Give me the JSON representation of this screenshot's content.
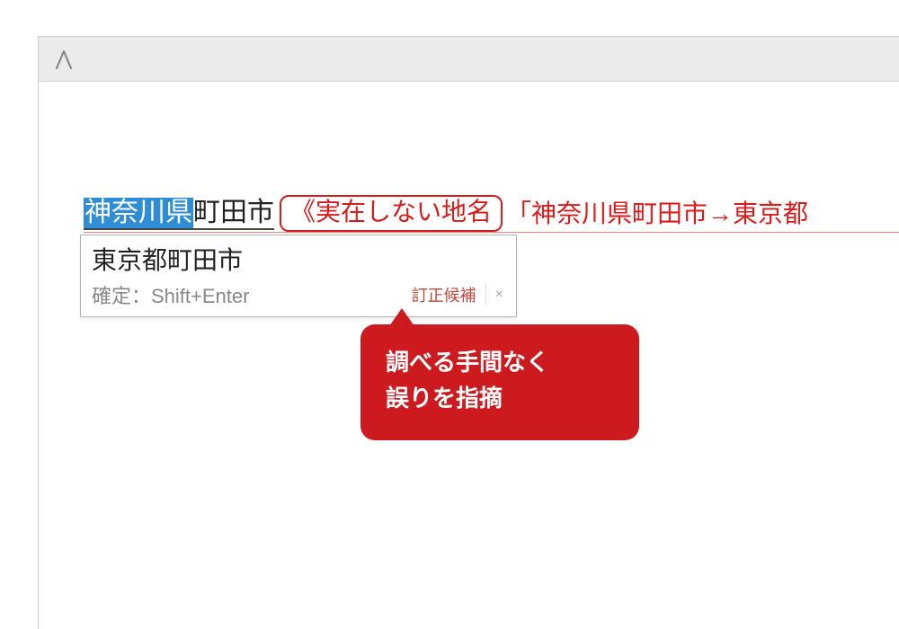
{
  "editor": {
    "selected": "神奈川県",
    "plain": "町田市",
    "annotation": "《実在しない地名",
    "trail": "「神奈川県町田市→東京都"
  },
  "suggestion": {
    "candidate": "東京都町田市",
    "confirm_hint": "確定：Shift+Enter",
    "footer_label": "訂正候補",
    "close": "×"
  },
  "callout": {
    "line1": "調べる手間なく",
    "line2": "誤りを指摘"
  }
}
